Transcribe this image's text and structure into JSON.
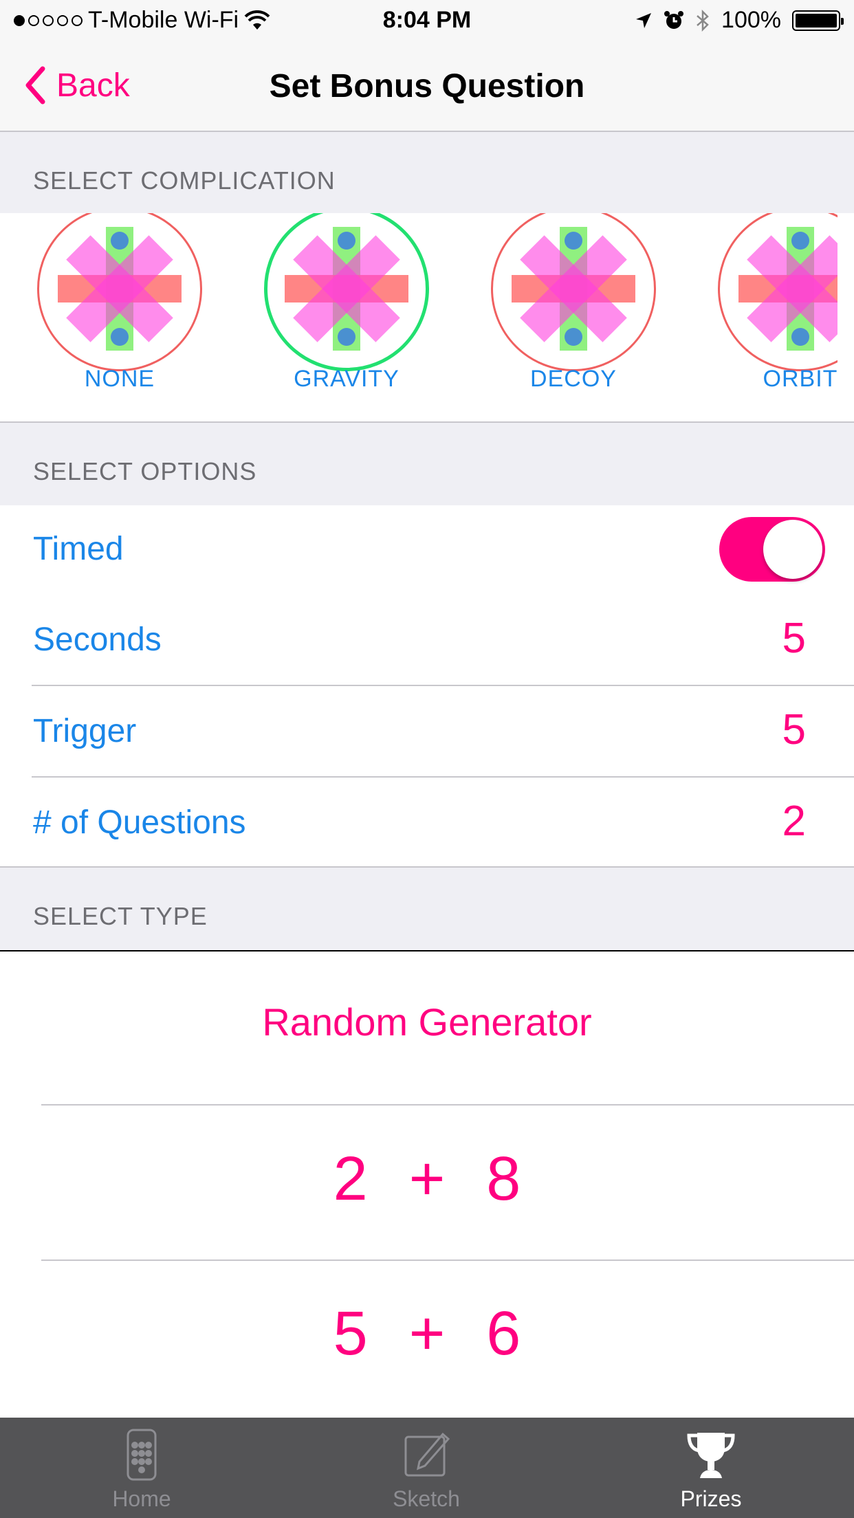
{
  "status_bar": {
    "carrier": "T-Mobile Wi-Fi",
    "time": "8:04 PM",
    "battery": "100%",
    "signal_dots_filled": 1,
    "signal_dots_total": 5
  },
  "nav": {
    "back_label": "Back",
    "title": "Set Bonus Question"
  },
  "sections": {
    "complication": "SELECT COMPLICATION",
    "options": "SELECT OPTIONS",
    "type": "SELECT TYPE"
  },
  "complications": [
    {
      "label": "NONE",
      "selected": false
    },
    {
      "label": "GRAVITY",
      "selected": true
    },
    {
      "label": "DECOY",
      "selected": false
    },
    {
      "label": "ORBIT",
      "selected": false
    }
  ],
  "options": {
    "timed": {
      "label": "Timed",
      "on": true
    },
    "seconds": {
      "label": "Seconds",
      "value": "5"
    },
    "trigger": {
      "label": "Trigger",
      "value": "5"
    },
    "questions": {
      "label": "# of Questions",
      "value": "2"
    }
  },
  "types": {
    "random_generator": "Random Generator",
    "equations": [
      {
        "a": "2",
        "op": "+",
        "b": "8"
      },
      {
        "a": "5",
        "op": "+",
        "b": "6"
      }
    ]
  },
  "tabs": [
    {
      "label": "Home",
      "icon": "keypad-icon",
      "active": false
    },
    {
      "label": "Sketch",
      "icon": "sketch-icon",
      "active": false
    },
    {
      "label": "Prizes",
      "icon": "trophy-icon",
      "active": true
    }
  ],
  "colors": {
    "accent": "#ff0080",
    "link_blue": "#1a86e8",
    "selected_ring": "#22e070",
    "unselected_ring": "#f06060"
  }
}
